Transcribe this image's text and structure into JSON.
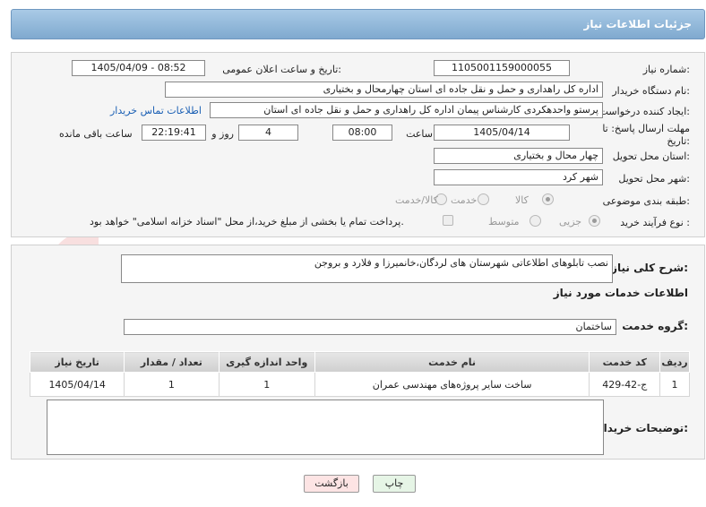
{
  "header": {
    "title": "جزئیات اطلاعات نیاز"
  },
  "need": {
    "number_label": "شماره نیاز:",
    "number_value": "1105001159000055",
    "announce_label": "تاریخ و ساعت اعلان عمومی:",
    "announce_value": "1405/04/09 - 08:52",
    "buyer_label": "نام دستگاه خریدار:",
    "buyer_value": "اداره کل راهداری و حمل و نقل جاده ای استان چهارمحال و بختیاری",
    "creator_label": "ایجاد کننده درخواست:",
    "creator_value": "پرستو واحدهکردی کارشناس پیمان اداره کل راهداری و حمل و نقل جاده ای استان",
    "contact_link": "اطلاعات تماس خریدار",
    "deadline_label": "مهلت ارسال پاسخ: تا تاریخ:",
    "deadline_date": "1405/04/14",
    "time_label": "ساعت",
    "deadline_time": "08:00",
    "days_value": "4",
    "days_label": "روز و",
    "remaining_value": "22:19:41",
    "remaining_label": "ساعت باقی مانده",
    "province_label": "استان محل تحویل:",
    "province_value": "چهار محال و بختیاری",
    "city_label": "شهر محل تحویل:",
    "city_value": "شهر کرد",
    "category_label": "طبقه بندی موضوعی:",
    "category_options": [
      "کالا",
      "خدمت",
      "کالا/خدمت"
    ],
    "category_selected": "کالا",
    "process_label": "نوع فرآیند خرید :",
    "process_options": [
      "جزیی",
      "متوسط"
    ],
    "process_selected": "جزیی",
    "treasury_text": "پرداخت تمام یا بخشی از مبلغ خرید،از محل \"اسناد خزانه اسلامی\" خواهد بود."
  },
  "summary": {
    "label": "شرح کلی نیاز:",
    "value": "نصب تابلوهای اطلاعاتی شهرستان های لردگان،خانمیرزا و فلارد و بروجن"
  },
  "services": {
    "section_title": "اطلاعات خدمات مورد نیاز",
    "group_label": "گروه خدمت:",
    "group_value": "ساختمان",
    "columns": [
      "ردیف",
      "کد خدمت",
      "نام خدمت",
      "واحد اندازه گیری",
      "تعداد / مقدار",
      "تاریخ نیاز"
    ],
    "rows": [
      {
        "index": "1",
        "code": "ج-42-429",
        "name": "ساخت سایر پروژه‌های مهندسی عمران",
        "unit": "1",
        "qty": "1",
        "date": "1405/04/14"
      }
    ]
  },
  "buyer_notes": {
    "label": "توضیحات خریدار:",
    "value": ""
  },
  "buttons": {
    "print": "چاپ",
    "back": "بازگشت"
  },
  "watermark": {
    "text": "AriaTender.net"
  },
  "colors": {
    "header": "#8fb6da",
    "link": "#1a5fb4",
    "back_button": "#fde4e4",
    "print_button": "#e6f5e6"
  }
}
